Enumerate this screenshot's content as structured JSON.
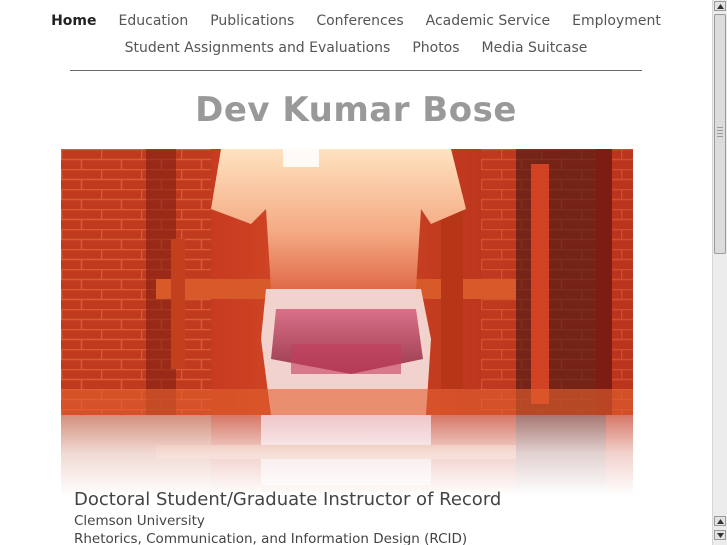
{
  "nav": {
    "row1": [
      {
        "label": "Home",
        "active": true
      },
      {
        "label": "Education"
      },
      {
        "label": "Publications"
      },
      {
        "label": "Conferences"
      },
      {
        "label": "Academic Service"
      },
      {
        "label": "Employment"
      }
    ],
    "row2": [
      {
        "label": "Student Assignments and Evaluations"
      },
      {
        "label": "Photos"
      },
      {
        "label": "Media Suitcase"
      }
    ]
  },
  "site": {
    "title": "Dev Kumar Bose"
  },
  "hero": {
    "icon": "photo-icon",
    "accent": "#c4321c"
  },
  "caption": {
    "title": "Doctoral Student/Graduate Instructor of Record",
    "line1": "Clemson University",
    "line2": "Rhetorics, Communication, and Information Design (RCID)"
  },
  "colors": {
    "nav_text": "#555555",
    "title_text": "#999999",
    "body_text": "#444444"
  }
}
